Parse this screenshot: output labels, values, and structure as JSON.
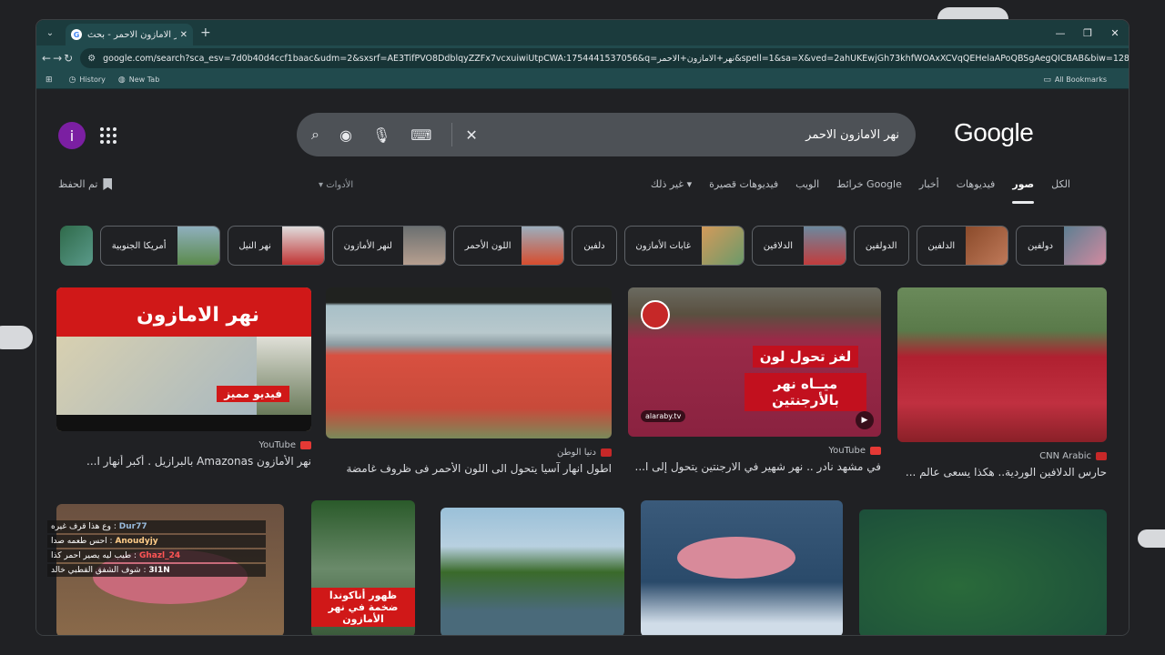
{
  "browser": {
    "tab_title": "نهر الامازون الاحمر - بحث Google",
    "url": "google.com/search?sca_esv=7d0b40d4ccf1baac&udm=2&sxsrf=AE3TifPVO8DdblqyZZFx7vcxuiwiUtpCWA:1754441537056&q=نهر+الامازون+الاحمر&spell=1&sa=X&ved=2ahUKEwjGh73khfWOAxXCVqQEHelaAPoQBSgAegQICBAB&biw=1280&bih=638...",
    "profile_initial": "i",
    "bookmarks": [
      "History",
      "New Tab"
    ],
    "all_bookmarks": "All Bookmarks"
  },
  "page": {
    "avatar_initial": "i",
    "logo": "Google",
    "query": "نهر الامازون الاحمر",
    "saved_label": "تم الحفظ",
    "tools_label": "الأدوات",
    "tabs": [
      "الكل",
      "صور",
      "فيديوهات",
      "أخبار",
      "خرائط Google",
      "الويب",
      "فيديوهات قصيرة",
      "غير ذلك"
    ],
    "active_tab": "صور",
    "chips": [
      {
        "label": "دولفين",
        "color": "#6c8ea0"
      },
      {
        "label": "الدلفين",
        "color": "#a05a3a"
      },
      {
        "label": "الدولفين",
        "color": ""
      },
      {
        "label": "الدلافين",
        "color": "#b43a3a"
      },
      {
        "label": "غابات الأمازون",
        "color": "#c97a4a"
      },
      {
        "label": "دلفين",
        "color": ""
      },
      {
        "label": "اللون الأحمر",
        "color": "#d84a2a"
      },
      {
        "label": "لنهر الأمازون",
        "color": "#8a8f90"
      },
      {
        "label": "نهر النيل",
        "color": "#b0b4b8"
      },
      {
        "label": "أمريكا الجنوبية",
        "color": "#6a9a6a"
      },
      {
        "label": "",
        "color": "#3f7a6a"
      }
    ],
    "results_row1": [
      {
        "source": "CNN Arabic",
        "title": "حارس الدلافين الوردية.. هكذا يسعى عالم ...",
        "overlay": "",
        "src_color": "#c62828"
      },
      {
        "source": "YouTube",
        "title": "في مشهد نادر .. نهر شهير في الارجنتين يتحول إلى ا...",
        "overlay": "لغز تحول لون ميــاه نهر بالأرجنتين",
        "src_color": "#e53935"
      },
      {
        "source": "دنيا الوطن",
        "title": "اطول انهار آسيا يتحول الى اللون الأحمر فى ظروف غامضة",
        "overlay": "",
        "src_color": "#c62828"
      },
      {
        "source": "YouTube",
        "title": "نهر الأمازون Amazonas بالبرازيل . أكبر أنهار ا...",
        "overlay": "نهر الامازون",
        "src_color": "#e53935"
      }
    ],
    "overlay_badge": "alaraby.tv",
    "overlay_video": "فيديو مميز",
    "overlay_nile": "ظهور أناكوندا ضخمة في نهر الأمازون",
    "chat": [
      {
        "user": "Dur77",
        "msg": "وع هذا قرف غيره"
      },
      {
        "user": "Anoudyjy",
        "msg": "احس طعمه صدا"
      },
      {
        "user": "Ghazl_24",
        "msg": "طيب ليه يصير احمر كذا"
      },
      {
        "user": "3I1N",
        "msg": "شوف الشفق القطبي خالد"
      }
    ]
  }
}
